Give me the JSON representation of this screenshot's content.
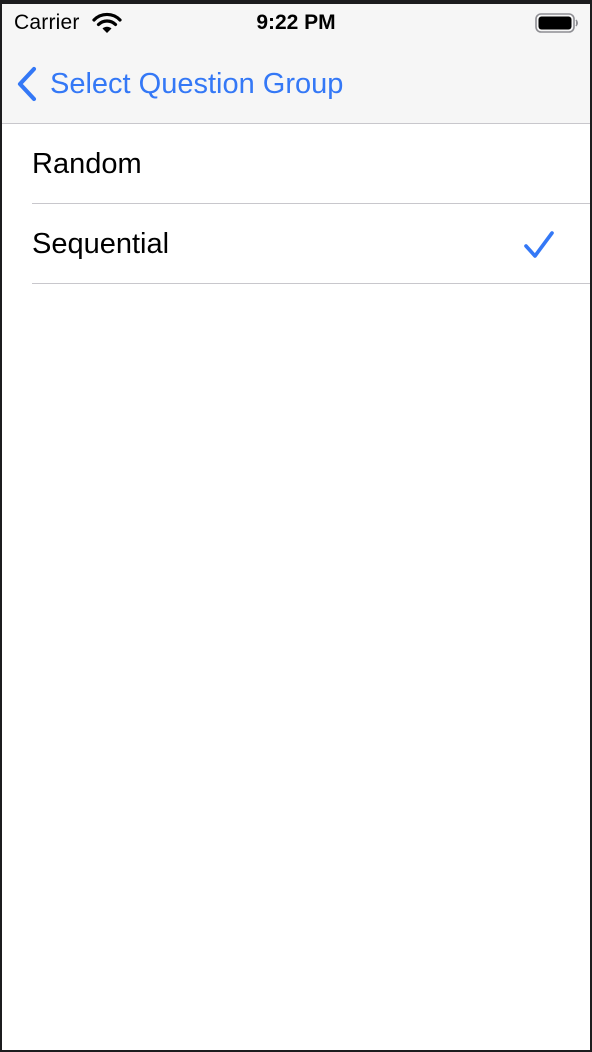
{
  "status_bar": {
    "carrier": "Carrier",
    "time": "9:22 PM",
    "wifi_icon": "wifi-icon",
    "battery_icon": "battery-full-icon"
  },
  "nav_bar": {
    "back_label": "Select Question Group",
    "back_icon": "chevron-left-icon"
  },
  "options": [
    {
      "label": "Random",
      "selected": false
    },
    {
      "label": "Sequential",
      "selected": true
    }
  ],
  "colors": {
    "accent": "#3478f6",
    "header_bg": "#f6f6f6",
    "separator": "#c8c7cc",
    "text": "#000000"
  }
}
